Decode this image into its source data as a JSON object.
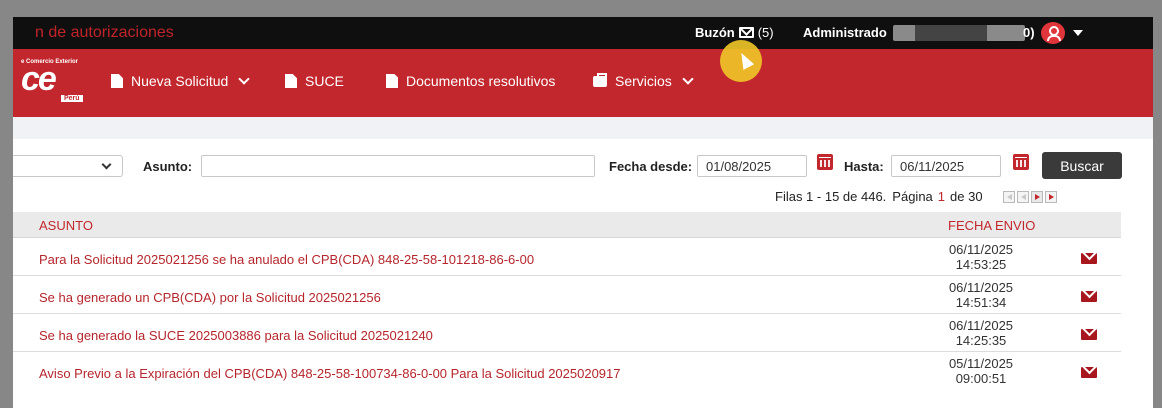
{
  "topbar": {
    "app_title": "n de autorizaciones",
    "mailbox_label": "Buzón",
    "mailbox_count": "(5)",
    "admin_label": "Administrado",
    "admin_tail": "0)"
  },
  "navbar": {
    "logo_small": "e Comercio Exterior",
    "logo_big": "ce",
    "logo_peru": "Perú",
    "items": [
      {
        "label": "Nueva Solicitud",
        "icon": "document-icon",
        "dropdown": true
      },
      {
        "label": "SUCE",
        "icon": "document-icon",
        "dropdown": false
      },
      {
        "label": "Documentos resolutivos",
        "icon": "document-sign-icon",
        "dropdown": false
      },
      {
        "label": "Servicios",
        "icon": "briefcase-icon",
        "dropdown": true
      }
    ]
  },
  "search": {
    "asunto_label": "Asunto:",
    "asunto_value": "",
    "fecha_desde_label": "Fecha desde:",
    "fecha_desde_value": "01/08/2025",
    "hasta_label": "Hasta:",
    "hasta_value": "06/11/2025",
    "buscar_label": "Buscar"
  },
  "pager": {
    "rows_text": "Filas 1 - 15 de 446.",
    "page_label": "Página",
    "current_page": "1",
    "total_text": "de 30"
  },
  "table": {
    "headers": {
      "asunto": "ASUNTO",
      "fecha": "FECHA ENVIO"
    },
    "rows": [
      {
        "subject": "Para la Solicitud 2025021256 se ha anulado el CPB(CDA) 848-25-58-101218-86-6-00",
        "date": "06/11/2025",
        "time": "14:53:25"
      },
      {
        "subject": "Se ha generado un CPB(CDA) por la Solicitud 2025021256",
        "date": "06/11/2025",
        "time": "14:51:34"
      },
      {
        "subject": "Se ha generado la SUCE 2025003886 para la Solicitud 2025021240",
        "date": "06/11/2025",
        "time": "14:25:35"
      },
      {
        "subject": "Aviso Previo a la Expiración del CPB(CDA) 848-25-58-100734-86-0-00 Para la Solicitud 2025020917",
        "date": "05/11/2025",
        "time": "09:00:51"
      }
    ]
  },
  "colors": {
    "brand_red": "#c2272d",
    "topbar": "#0f0f0f",
    "button": "#3a3a3a"
  }
}
